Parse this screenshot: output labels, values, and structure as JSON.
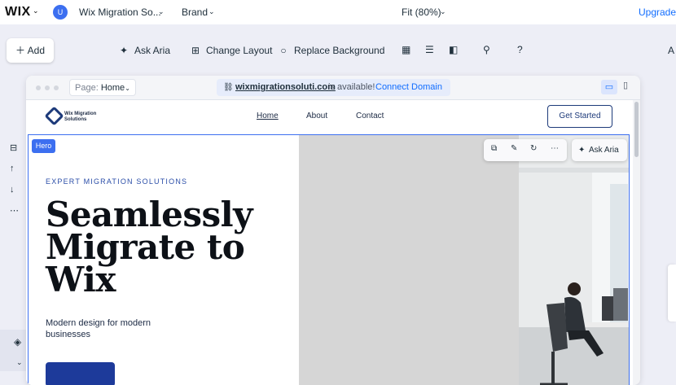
{
  "topbar": {
    "logo": "WIX",
    "avatar_initial": "U",
    "site_name": "Wix Migration So...",
    "brand_label": "Brand",
    "zoom_label": "Fit (80%)",
    "upgrade_label": "Upgrade"
  },
  "toolbar": {
    "add_label": "Add",
    "ask_aria_label": "Ask Aria",
    "change_layout_label": "Change Layout",
    "replace_background_label": "Replace Background",
    "help_label": "?",
    "cut_off_label": "A"
  },
  "browser": {
    "page_label": "Page:",
    "page_value": "Home",
    "domain_name": "wixmigrationsoluti.com",
    "domain_status": "is available!",
    "connect_label": "Connect Domain"
  },
  "site": {
    "logo_text_line1": "Wix Migration",
    "logo_text_line2": "Solutions",
    "nav": [
      "Home",
      "About",
      "Contact"
    ],
    "cta_label": "Get Started"
  },
  "hero": {
    "tag": "Hero",
    "eyebrow": "EXPERT MIGRATION SOLUTIONS",
    "headline": "Seamlessly\nMigrate to\nWix",
    "subtext": "Modern design for modern businesses",
    "ask_aria_label": "Ask Aria"
  },
  "colors": {
    "accent": "#116dff",
    "selection": "#3c6ff0",
    "brand_navy": "#1d3a7a",
    "canvas_bg": "#edeef6"
  }
}
